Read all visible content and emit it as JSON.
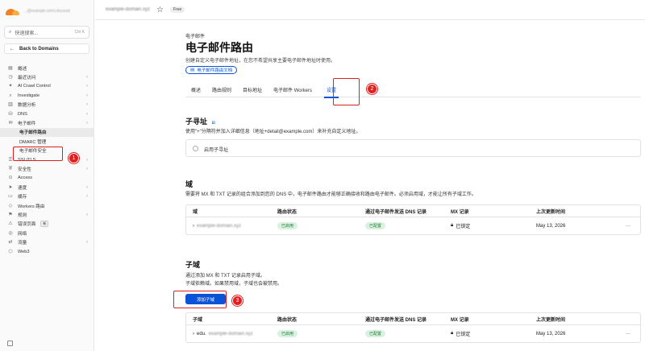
{
  "sidebar": {
    "account_name": "...@example.com's Account",
    "search_placeholder": "快速搜索...",
    "search_shortcut": "Ctrl K",
    "back_label": "Back to Domains",
    "items": [
      {
        "label": "概述",
        "icon": "overview-icon",
        "chevron": false
      },
      {
        "label": "最近访问",
        "icon": "clock-icon",
        "chevron": true
      },
      {
        "label": "AI Crawl Control",
        "icon": "ai-icon",
        "chevron": true
      },
      {
        "label": "Investigate",
        "icon": "investigate-icon",
        "chevron": true
      },
      {
        "label": "数据分析",
        "icon": "analytics-icon",
        "chevron": true
      },
      {
        "label": "DNS",
        "icon": "dns-icon",
        "chevron": true
      },
      {
        "label": "电子邮件",
        "icon": "email-icon",
        "chevron": true
      },
      {
        "label": "电子邮件路由",
        "sub": true,
        "active": true
      },
      {
        "label": "DMARC 管理",
        "sub": true
      },
      {
        "label": "电子邮件安全",
        "sub": true
      },
      {
        "label": "SSL/TLS",
        "icon": "lock-icon",
        "chevron": true
      },
      {
        "label": "安全性",
        "icon": "shield-icon",
        "chevron": true
      },
      {
        "label": "Access",
        "icon": "access-icon",
        "chevron": false
      },
      {
        "label": "速度",
        "icon": "speed-icon",
        "chevron": true
      },
      {
        "label": "缓存",
        "icon": "cache-icon",
        "chevron": true
      },
      {
        "label": "Workers 路由",
        "icon": "workers-icon",
        "chevron": false
      },
      {
        "label": "规则",
        "icon": "rules-icon",
        "chevron": true
      },
      {
        "label": "错误页面",
        "icon": "error-page-icon",
        "chevron": false,
        "badge": "新"
      },
      {
        "label": "网络",
        "icon": "network-icon",
        "chevron": false
      },
      {
        "label": "流量",
        "icon": "traffic-icon",
        "chevron": true
      },
      {
        "label": "Web3",
        "icon": "web3-icon",
        "chevron": false
      }
    ]
  },
  "topbar": {
    "domain": "example-domain.xyz",
    "plan": "Free"
  },
  "header": {
    "breadcrumb": "电子邮件",
    "title": "电子邮件路由",
    "description": "创建自定义电子邮件地址，在您不希望共享主要电子邮件地址时使用。",
    "doc_link": "电子邮件路由文档"
  },
  "tabs": [
    "概述",
    "路由规则",
    "目标地址",
    "电子邮件 Workers",
    "设置"
  ],
  "subaddress": {
    "title": "子寻址",
    "description": "使用\"+\"分隔符并加入详细信息（地址+detail@example.com）来补充自定义地址。",
    "option_label": "启用子寻址"
  },
  "domain_section": {
    "title": "域",
    "description": "需要将 MX 和 TXT 记录的组合添加到您的 DNS 中，电子邮件路由才能够正确接收和路由电子邮件。必须启用域，才能让所有子域工作。",
    "columns": [
      "域",
      "路由状态",
      "通过电子邮件发送 DNS 记录",
      "MX 记录",
      "上次更新时间"
    ],
    "rows": [
      {
        "name": "example-domain.xyz",
        "route_status": "已启用",
        "dns_status": "已配置",
        "mx": "已锁定",
        "updated": "May 13, 2026"
      }
    ]
  },
  "subdomain_section": {
    "title": "子域",
    "description_line1": "通过添加 MX 和 TXT 记录启用子域。",
    "description_line2": "子域依赖域。如果禁用域，子域也会被禁用。",
    "add_button": "添加子域",
    "columns": [
      "子域",
      "路由状态",
      "通过电子邮件发送 DNS 记录",
      "MX 记录",
      "上次更新时间"
    ],
    "rows": [
      {
        "prefix": "edu.",
        "name": "example-domain.xyz",
        "route_status": "已启用",
        "dns_status": "已配置",
        "mx": "已锁定",
        "updated": "May 13, 2026"
      }
    ]
  },
  "annotations": [
    "1",
    "2",
    "3"
  ],
  "colors": {
    "accent": "#0a53d8",
    "annotation": "#e21f1f",
    "success_bg": "#d9f2df",
    "success_text": "#1a7f37",
    "brand_orange": "#f48120"
  }
}
